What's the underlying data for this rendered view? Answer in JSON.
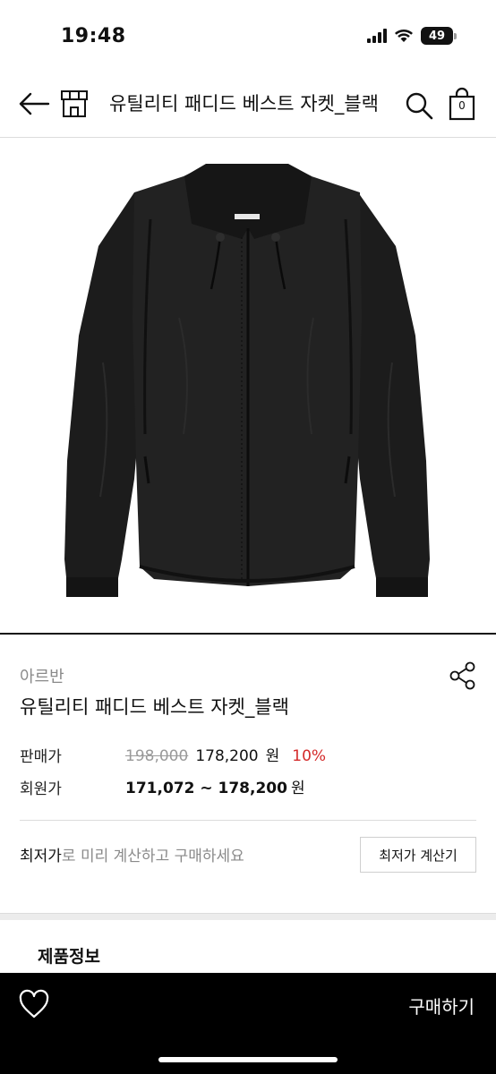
{
  "status_bar": {
    "time": "19:48",
    "battery": "49",
    "icons": [
      "signal-icon",
      "wifi-icon",
      "battery-icon"
    ]
  },
  "header": {
    "title": "유틸리티 패디드 베스트 자켓_블랙",
    "cart_count": "0",
    "icons": [
      "back-arrow-icon",
      "store-home-icon",
      "search-icon",
      "shopping-bag-icon"
    ]
  },
  "product": {
    "brand": "아르반",
    "name": "유틸리티 패디드 베스트 자켓_블랙",
    "price_label": "판매가",
    "original_price": "198,000",
    "sale_price": "178,200",
    "won": "원",
    "discount": "10%",
    "member_label": "회원가",
    "member_price": "171,072 ~ 178,200",
    "member_won": "원"
  },
  "lowest_price": {
    "strong": "최저가",
    "rest": "로 미리 계산하고 구매하세요",
    "button": "최저가 계산기"
  },
  "section": {
    "product_info": "제품정보"
  },
  "bottom_bar": {
    "buy_label": "구매하기",
    "icons": [
      "heart-icon"
    ]
  },
  "colors": {
    "discount": "#d42a2a",
    "bottom_bar": "#000000",
    "muted": "#8a8a8a"
  }
}
